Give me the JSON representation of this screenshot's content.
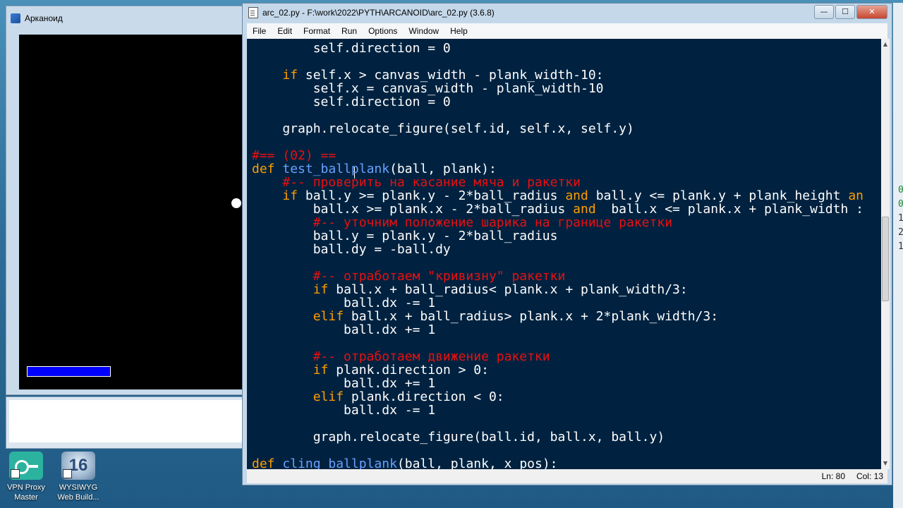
{
  "desktop": {
    "icons": [
      {
        "label": "VPN Proxy Master",
        "icon": "vpn-key-icon"
      },
      {
        "label": "WYSIWYG Web Build...",
        "icon": "wysiwyg-16-icon",
        "badge": "16"
      }
    ]
  },
  "game_window": {
    "title": "Арканоид",
    "canvas_color": "#000000",
    "plank_color": "#0000ff",
    "ball_color": "#ffffff"
  },
  "editor": {
    "title": "arc_02.py - F:\\work\\2022\\PYTH\\ARCANOID\\arc_02.py (3.6.8)",
    "controls": {
      "minimize": "—",
      "maximize": "☐",
      "close": "✕"
    },
    "menu": [
      "File",
      "Edit",
      "Format",
      "Run",
      "Options",
      "Window",
      "Help"
    ],
    "colors": {
      "background": "#002240",
      "keyword": "#ff9d00",
      "definition": "#6aa0ff",
      "comment": "#e81010",
      "text": "#ffffff"
    },
    "lines": [
      [
        {
          "t": "        self.direction = 0",
          "c": "plain"
        }
      ],
      [],
      [
        {
          "t": "    ",
          "c": "plain"
        },
        {
          "t": "if",
          "c": "kw"
        },
        {
          "t": " self.x > canvas_width - plank_width-10:",
          "c": "plain"
        }
      ],
      [
        {
          "t": "        self.x = canvas_width - plank_width-10",
          "c": "plain"
        }
      ],
      [
        {
          "t": "        self.direction = 0",
          "c": "plain"
        }
      ],
      [],
      [
        {
          "t": "    graph.relocate_figure(self.id, self.x, self.y)",
          "c": "plain"
        }
      ],
      [],
      [
        {
          "t": "#== (02) ==",
          "c": "com"
        }
      ],
      [
        {
          "t": "def",
          "c": "kw"
        },
        {
          "t": " ",
          "c": "plain"
        },
        {
          "t": "test_ballplank",
          "c": "def"
        },
        {
          "t": "(ball, plank):",
          "c": "plain"
        }
      ],
      [
        {
          "t": "    #-- проверить на касание мяча и ракетки",
          "c": "com"
        }
      ],
      [
        {
          "t": "    ",
          "c": "plain"
        },
        {
          "t": "if",
          "c": "kw"
        },
        {
          "t": " ball.y >= plank.y - 2*ball_radius ",
          "c": "plain"
        },
        {
          "t": "and",
          "c": "kw"
        },
        {
          "t": " ball.y <= plank.y + plank_height ",
          "c": "plain"
        },
        {
          "t": "an",
          "c": "kw"
        }
      ],
      [
        {
          "t": "        ball.x >= plank.x - 2*ball_radius ",
          "c": "plain"
        },
        {
          "t": "and",
          "c": "kw"
        },
        {
          "t": "  ball.x <= plank.x + plank_width :",
          "c": "plain"
        }
      ],
      [
        {
          "t": "        #-- уточним положение шарика на границе ракетки",
          "c": "com"
        }
      ],
      [
        {
          "t": "        ball.y = plank.y - 2*ball_radius",
          "c": "plain"
        }
      ],
      [
        {
          "t": "        ball.dy = -ball.dy",
          "c": "plain"
        }
      ],
      [],
      [
        {
          "t": "        #-- отработаем \"кривизну\" ракетки",
          "c": "com"
        }
      ],
      [
        {
          "t": "        ",
          "c": "plain"
        },
        {
          "t": "if",
          "c": "kw"
        },
        {
          "t": " ball.x + ball_radius< plank.x + plank_width/3:",
          "c": "plain"
        }
      ],
      [
        {
          "t": "            ball.dx -= 1",
          "c": "plain"
        }
      ],
      [
        {
          "t": "        ",
          "c": "plain"
        },
        {
          "t": "elif",
          "c": "kw"
        },
        {
          "t": " ball.x + ball_radius> plank.x + 2*plank_width/3:",
          "c": "plain"
        }
      ],
      [
        {
          "t": "            ball.dx += 1",
          "c": "plain"
        }
      ],
      [],
      [
        {
          "t": "        #-- отработаем движение ракетки",
          "c": "com"
        }
      ],
      [
        {
          "t": "        ",
          "c": "plain"
        },
        {
          "t": "if",
          "c": "kw"
        },
        {
          "t": " plank.direction > 0:",
          "c": "plain"
        }
      ],
      [
        {
          "t": "            ball.dx += 1",
          "c": "plain"
        }
      ],
      [
        {
          "t": "        ",
          "c": "plain"
        },
        {
          "t": "elif",
          "c": "kw"
        },
        {
          "t": " plank.direction < 0:",
          "c": "plain"
        }
      ],
      [
        {
          "t": "            ball.dx -= 1",
          "c": "plain"
        }
      ],
      [],
      [
        {
          "t": "        graph.relocate_figure(ball.id, ball.x, ball.y)",
          "c": "plain"
        }
      ],
      [],
      [
        {
          "t": "def",
          "c": "kw"
        },
        {
          "t": " ",
          "c": "plain"
        },
        {
          "t": "cling_ballplank",
          "c": "def"
        },
        {
          "t": "(ball, plank, x_pos):",
          "c": "plain"
        }
      ]
    ],
    "status": {
      "line": "Ln: 80",
      "col": "Col: 13"
    }
  },
  "background_window": {
    "glyphs": [
      "0",
      "0",
      "1",
      "2",
      "1"
    ]
  }
}
